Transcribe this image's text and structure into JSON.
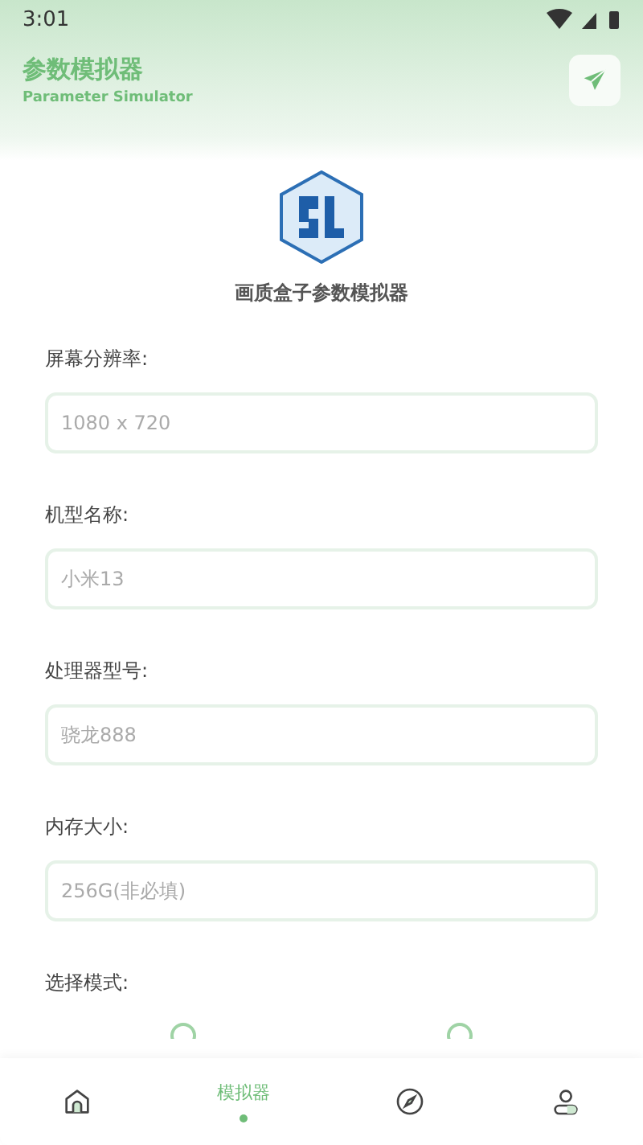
{
  "status_bar": {
    "time": "3:01"
  },
  "header": {
    "title": "参数模拟器",
    "subtitle": "Parameter Simulator"
  },
  "app_name": "画质盒子参数模拟器",
  "fields": [
    {
      "label": "屏幕分辨率:",
      "placeholder": "1080 x 720"
    },
    {
      "label": "机型名称:",
      "placeholder": "小米13"
    },
    {
      "label": "处理器型号:",
      "placeholder": "骁龙888"
    },
    {
      "label": "内存大小:",
      "placeholder": "256G(非必填)"
    }
  ],
  "mode": {
    "label": "选择模式:"
  },
  "nav": [
    {
      "kind": "home",
      "selected": false
    },
    {
      "label": "模拟器",
      "selected": true
    },
    {
      "kind": "discover",
      "selected": false
    },
    {
      "kind": "profile",
      "selected": false
    }
  ]
}
